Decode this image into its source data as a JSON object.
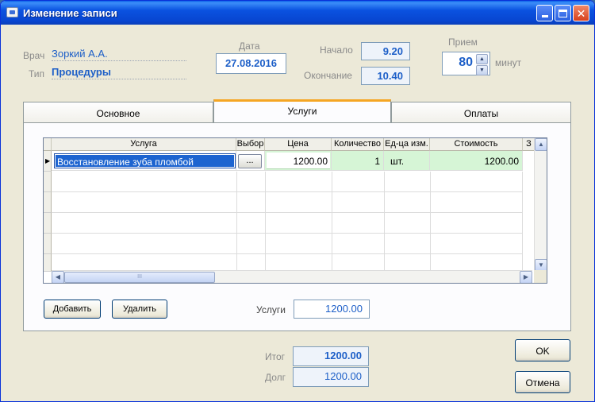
{
  "window": {
    "title": "Изменение записи"
  },
  "header": {
    "doctor_label": "Врач",
    "doctor_value": "Зоркий А.А.",
    "type_label": "Тип",
    "type_value": "Процедуры",
    "date_label": "Дата",
    "date_value": "27.08.2016",
    "start_label": "Начало",
    "start_value": "9.20",
    "end_label": "Окончание",
    "end_value": "10.40",
    "reception_label": "Прием",
    "reception_value": "80",
    "minutes_label": "минут"
  },
  "tabs": [
    {
      "label": "Основное",
      "active": false
    },
    {
      "label": "Услуги",
      "active": true
    },
    {
      "label": "Оплаты",
      "active": false
    }
  ],
  "grid": {
    "columns": [
      "Услуга",
      "Выбор",
      "Цена",
      "Количество",
      "Ед-ца изм.",
      "Стоимость",
      "З"
    ],
    "rows": [
      {
        "service": "Восстановление зуба пломбой",
        "choose": "...",
        "price": "1200.00",
        "qty": "1",
        "unit": "шт.",
        "cost": "1200.00"
      }
    ],
    "hscroll_grip": "III"
  },
  "buttons": {
    "add": "Добавить",
    "delete": "Удалить",
    "ok": "OK",
    "cancel": "Отмена"
  },
  "totals": {
    "services_label": "Услуги",
    "services_value": "1200.00",
    "total_label": "Итог",
    "total_value": "1200.00",
    "debt_label": "Долг",
    "debt_value": "1200.00"
  },
  "icons": {
    "indicator": "row-pointer-icon"
  }
}
